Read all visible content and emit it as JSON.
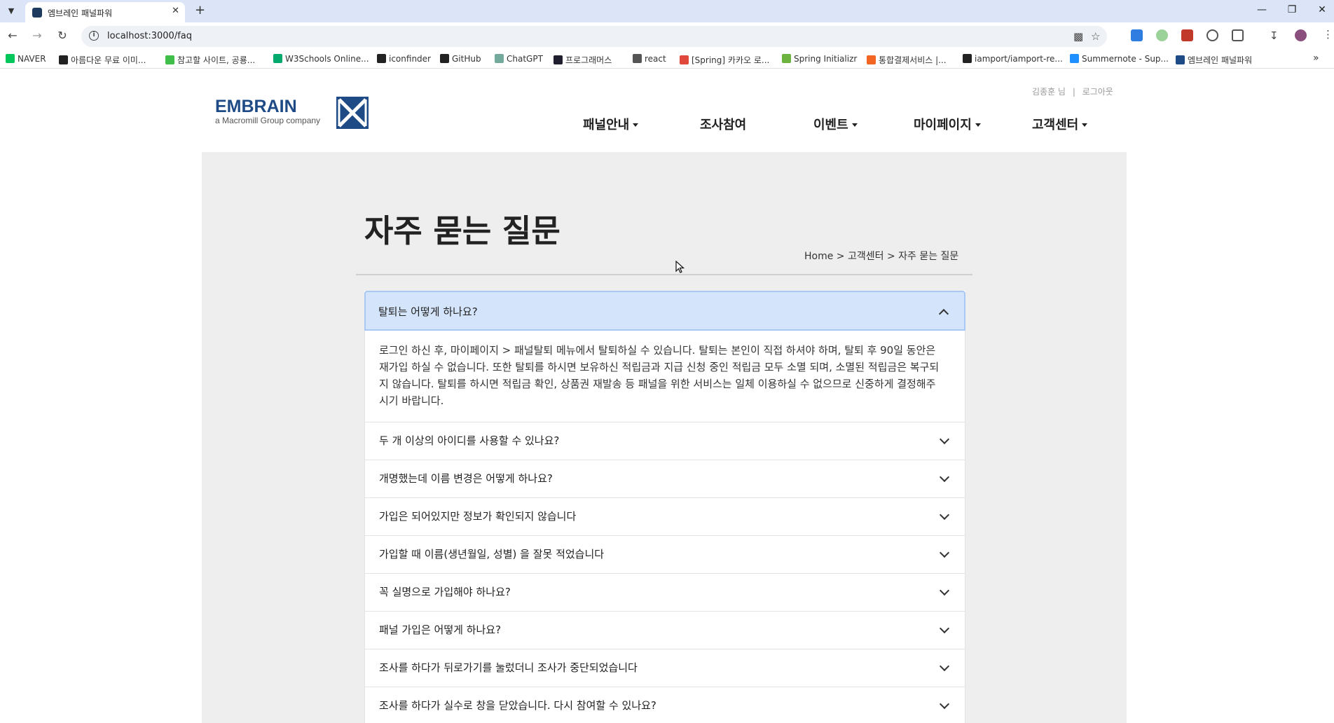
{
  "browser": {
    "tab_title": "엠브레인 패널파워",
    "url": "localhost:3000/faq",
    "bookmarks": [
      {
        "label": "NAVER",
        "color": "#03c75a"
      },
      {
        "label": "아름다운 무료 이미...",
        "color": "#222222"
      },
      {
        "label": "참고할 사이트, 공룡...",
        "color": "#3fbf4a"
      },
      {
        "label": "W3Schools Online...",
        "color": "#04aa6d"
      },
      {
        "label": "iconfinder",
        "color": "#222222"
      },
      {
        "label": "GitHub",
        "color": "#222222"
      },
      {
        "label": "ChatGPT",
        "color": "#74aa9c"
      },
      {
        "label": "프로그래머스",
        "color": "#1e1e2e"
      },
      {
        "label": "react",
        "color": "#555555"
      },
      {
        "label": "[Spring] 카카오 로...",
        "color": "#e0483b"
      },
      {
        "label": "Spring Initializr",
        "color": "#6db33f"
      },
      {
        "label": "통합결제서비스 |...",
        "color": "#f26522"
      },
      {
        "label": "iamport/iamport-re...",
        "color": "#222222"
      },
      {
        "label": "Summernote - Sup...",
        "color": "#1e90ff"
      },
      {
        "label": "엠브레인 패널파워",
        "color": "#1e4b86"
      }
    ]
  },
  "header": {
    "user_name": "김종훈 님",
    "separator": "|",
    "logout": "로그아웃",
    "logo_main": "EMBRAIN",
    "logo_sub": "a Macromill Group company",
    "nav": [
      {
        "label": "패널안내",
        "dropdown": true
      },
      {
        "label": "조사참여",
        "dropdown": false
      },
      {
        "label": "이벤트",
        "dropdown": true
      },
      {
        "label": "마이페이지",
        "dropdown": true
      },
      {
        "label": "고객센터",
        "dropdown": true
      }
    ]
  },
  "page": {
    "title": "자주 묻는 질문",
    "breadcrumb": "Home > 고객센터 > 자주 묻는 질문"
  },
  "faq": [
    {
      "question": "탈퇴는 어떻게 하나요?",
      "open": true,
      "answer": "로그인 하신 후, 마이페이지 > 패널탈퇴 메뉴에서 탈퇴하실 수 있습니다. 탈퇴는 본인이 직접 하셔야 하며, 탈퇴 후 90일 동안은 재가입 하실 수 없습니다. 또한 탈퇴를 하시면 보유하신 적립금과 지급 신청 중인 적립금 모두 소멸 되며, 소멸된 적립금은 복구되지 않습니다. 탈퇴를 하시면 적립금 확인, 상품권 재발송 등 패널을 위한 서비스는 일체 이용하실 수 없으므로 신중하게 결정해주시기 바랍니다."
    },
    {
      "question": "두 개 이상의 아이디를 사용할 수 있나요?",
      "open": false
    },
    {
      "question": "개명했는데 이름 변경은 어떻게 하나요?",
      "open": false
    },
    {
      "question": "가입은 되어있지만 정보가 확인되지 않습니다",
      "open": false
    },
    {
      "question": "가입할 때 이름(생년월일, 성별) 을 잘못 적었습니다",
      "open": false
    },
    {
      "question": "꼭 실명으로 가입해야 하나요?",
      "open": false
    },
    {
      "question": "패널 가입은 어떻게 하나요?",
      "open": false
    },
    {
      "question": "조사를 하다가 뒤로가기를 눌렀더니 조사가 중단되었습니다",
      "open": false
    },
    {
      "question": "조사를 하다가 실수로 창을 닫았습니다. 다시 참여할 수 있나요?",
      "open": false
    }
  ]
}
